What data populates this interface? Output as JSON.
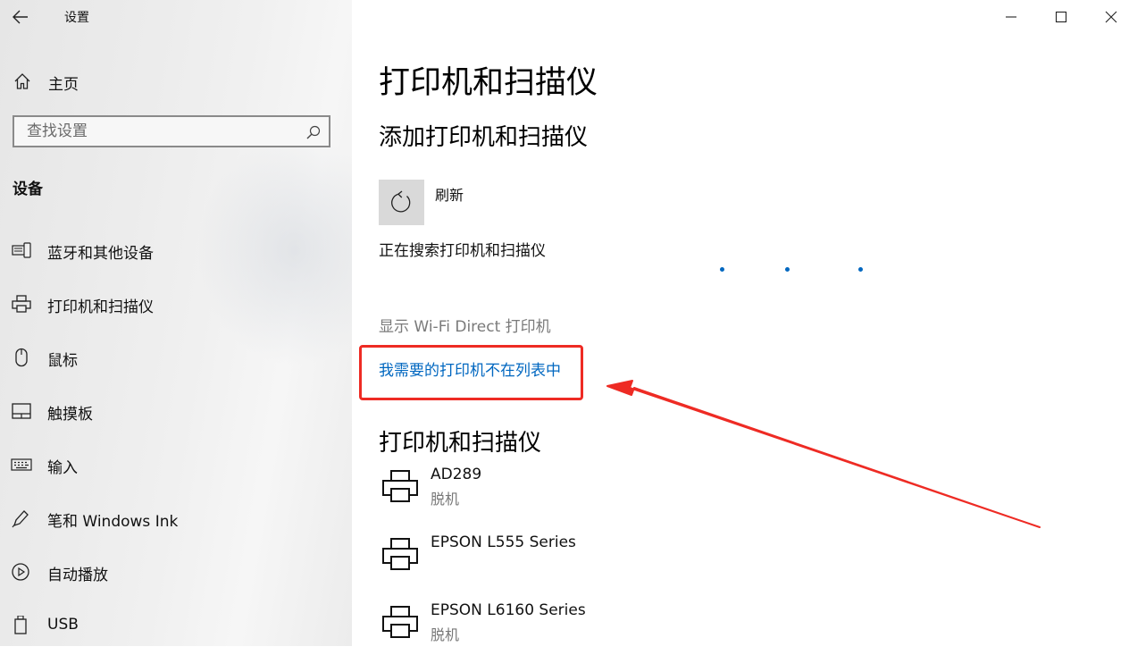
{
  "window": {
    "title": "设置"
  },
  "sidebar": {
    "home_label": "主页",
    "search_placeholder": "查找设置",
    "section_title": "设备",
    "items": [
      {
        "label": "蓝牙和其他设备",
        "icon": "bluetooth-devices-icon"
      },
      {
        "label": "打印机和扫描仪",
        "icon": "printer-icon"
      },
      {
        "label": "鼠标",
        "icon": "mouse-icon"
      },
      {
        "label": "触摸板",
        "icon": "touchpad-icon"
      },
      {
        "label": "输入",
        "icon": "keyboard-icon"
      },
      {
        "label": "笔和 Windows Ink",
        "icon": "pen-icon"
      },
      {
        "label": "自动播放",
        "icon": "autoplay-icon"
      },
      {
        "label": "USB",
        "icon": "usb-icon"
      }
    ]
  },
  "main": {
    "title": "打印机和扫描仪",
    "add_section_title": "添加打印机和扫描仪",
    "refresh_label": "刷新",
    "searching_text": "正在搜索打印机和扫描仪",
    "wifi_direct_label": "显示 Wi-Fi Direct 打印机",
    "missing_printer_link": "我需要的打印机不在列表中",
    "printers_section_title": "打印机和扫描仪",
    "printers": [
      {
        "name": "AD289",
        "status": "脱机"
      },
      {
        "name": "EPSON L555 Series",
        "status": ""
      },
      {
        "name": "EPSON L6160 Series",
        "status": "脱机"
      }
    ]
  },
  "colors": {
    "accent": "#0067c0",
    "annotation_red": "#ee2b24",
    "secondary_text": "#7a7a7a"
  }
}
